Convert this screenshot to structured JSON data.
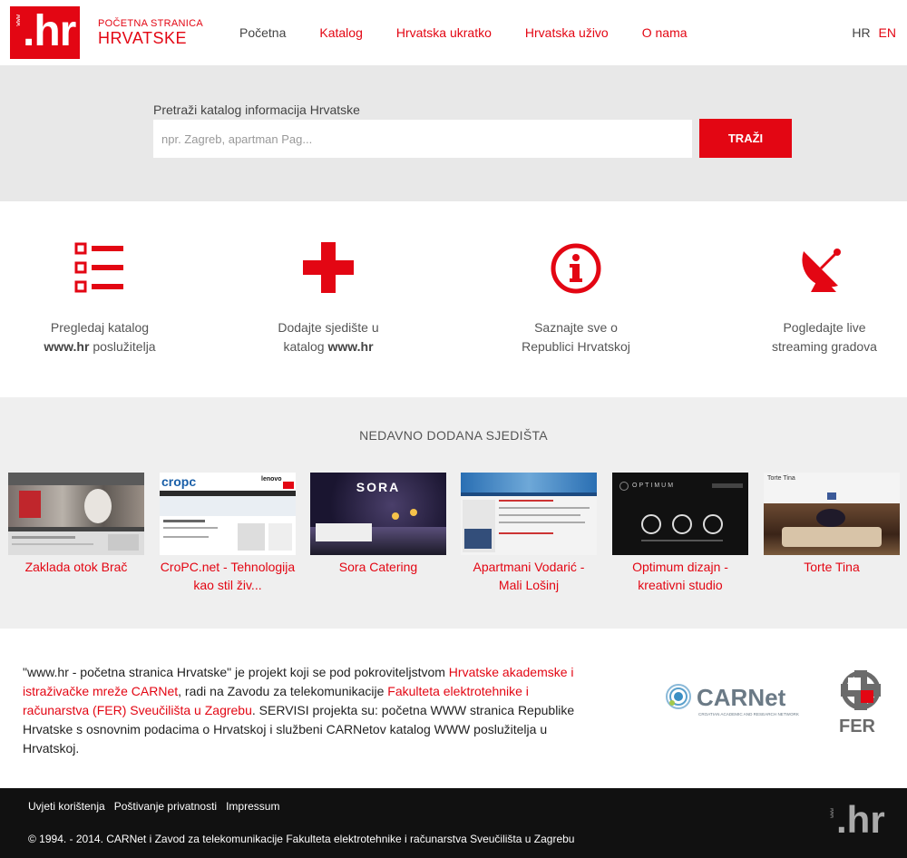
{
  "header": {
    "logo_www": "www",
    "logo_text": ".hr",
    "brand_small": "POČETNA STRANICA",
    "brand_big": "HRVATSKE",
    "nav": [
      "Početna",
      "Katalog",
      "Hrvatska ukratko",
      "Hrvatska uživo",
      "O nama"
    ],
    "lang_hr": "HR",
    "lang_en": "EN"
  },
  "search": {
    "label": "Pretraži katalog informacija Hrvatske",
    "placeholder": "npr. Zagreb, apartman Pag...",
    "button": "TRAŽI"
  },
  "features": [
    {
      "line1": "Pregledaj katalog",
      "bold": "www.hr",
      "rest": " poslužitelja",
      "icon": "list-icon"
    },
    {
      "line1": "Dodajte sjedište u",
      "pre": "katalog ",
      "bold": "www.hr",
      "icon": "plus-icon"
    },
    {
      "line1": "Saznajte sve o",
      "line2": "Republici Hrvatskoj",
      "icon": "info-icon"
    },
    {
      "line1": "Pogledajte live",
      "line2": "streaming gradova",
      "icon": "satellite-dish-icon"
    }
  ],
  "recent": {
    "title": "NEDAVNO DODANA SJEDIŠTA",
    "items": [
      {
        "label": "Zaklada otok Brač"
      },
      {
        "label": "CroPC.net - Tehnologija kao stil živ..."
      },
      {
        "label": "Sora Catering"
      },
      {
        "label": "Apartmani Vodarić - Mali Lošinj"
      },
      {
        "label": "Optimum dizajn - kreativni studio"
      },
      {
        "label": "Torte Tina"
      }
    ],
    "thumb_texts": {
      "cropc": "cropc",
      "lenovo": "lenovo",
      "sora": "SORA",
      "optimum": "OPTIMUM",
      "torte": "Torte Tina"
    }
  },
  "about": {
    "t1": "\"www.hr - početna stranica Hrvatske\" je projekt koji se pod pokroviteljstvom ",
    "l1": "Hrvatske akademske i istraživačke mreže CARNet",
    "t2": ", radi na Zavodu za telekomunikacije ",
    "l2": "Fakulteta elektrotehnike i računarstva (FER) Sveučilišta u Zagrebu",
    "t3": ". SERVISI projekta su: početna WWW stranica Republike Hrvatske s osnovnim podacima o Hrvatskoj i službeni CARNetov katalog WWW poslužitelja u Hrvatskoj.",
    "carnet_name": "CARNet",
    "carnet_sub": "CROATIAN ACADEMIC AND RESEARCH NETWORK",
    "fer_name": "FER"
  },
  "footer": {
    "links": [
      "Uvjeti korištenja",
      "Poštivanje privatnosti",
      "Impressum"
    ],
    "copyright": "© 1994. - 2014. CARNet i Zavod za telekomunikacije Fakulteta elektrotehnike i računarstva Sveučilišta u Zagrebu",
    "logo_www": "www",
    "logo_text": ".hr"
  },
  "colors": {
    "accent": "#e30613",
    "search_band": "#e8e8e8",
    "recent_band": "#efefef",
    "footer": "#111111"
  }
}
